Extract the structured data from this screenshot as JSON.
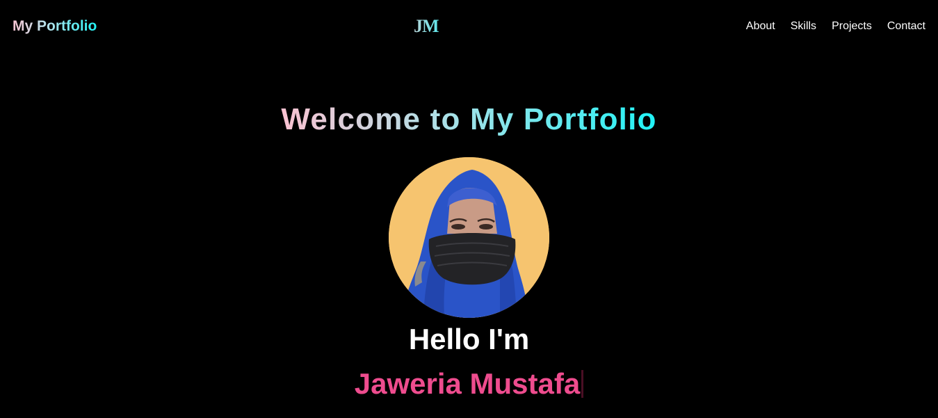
{
  "header": {
    "brand": "My Portfolio",
    "logo_initials": "JM",
    "nav": [
      {
        "label": "About"
      },
      {
        "label": "Skills"
      },
      {
        "label": "Projects"
      },
      {
        "label": "Contact"
      }
    ]
  },
  "hero": {
    "title": "Welcome to My Portfolio",
    "greeting": "Hello I'm",
    "name": "Jaweria Mustafa",
    "avatar_icon": "profile-photo"
  },
  "colors": {
    "background": "#000000",
    "name_accent": "#ee4c8e",
    "gradient_start": "#fbc2d1",
    "gradient_end": "#1ff3f6",
    "avatar_bg": "#f6c46f"
  }
}
